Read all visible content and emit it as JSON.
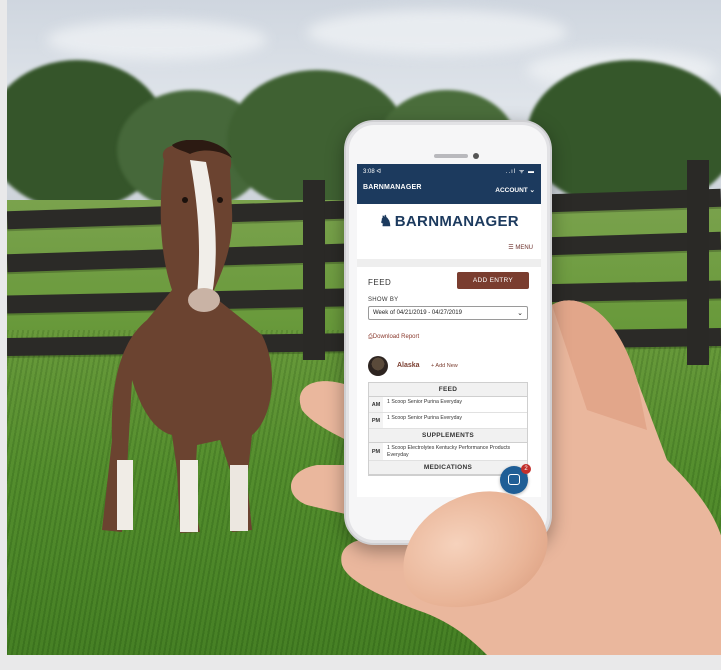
{
  "status_bar": {
    "time": "3:08 ᐊ",
    "icons": "..ıl ᯤ ▬"
  },
  "nav": {
    "logo": "BARNMANAGER",
    "account": "ACCOUNT ⌄"
  },
  "brand": {
    "name": "BARNMANAGER"
  },
  "menu": {
    "label": "☰ MENU"
  },
  "feed": {
    "title": "FEED",
    "add_entry": "ADD ENTRY",
    "show_by": "SHOW BY",
    "week": "Week of 04/21/2019 - 04/27/2019",
    "download": "⎙Download Report"
  },
  "horse": {
    "name": "Alaska",
    "add_new": "+ Add New"
  },
  "table": {
    "feed_header": "FEED",
    "feed_rows": [
      {
        "label": "AM",
        "text": "1 Scoop Senior Purina Everyday"
      },
      {
        "label": "PM",
        "text": "1 Scoop Senior Purina Everyday"
      }
    ],
    "supplements_header": "SUPPLEMENTS",
    "supplement_rows": [
      {
        "label": "PM",
        "text": "1 Scoop Electrolytes Kentucky Performance Products Everyday"
      }
    ],
    "medications_header": "MEDICATIONS"
  },
  "chat": {
    "badge": "2"
  },
  "colors": {
    "navy": "#1c3a5e",
    "brown_button": "#7a3d2f",
    "chat_blue": "#1f5e96"
  }
}
